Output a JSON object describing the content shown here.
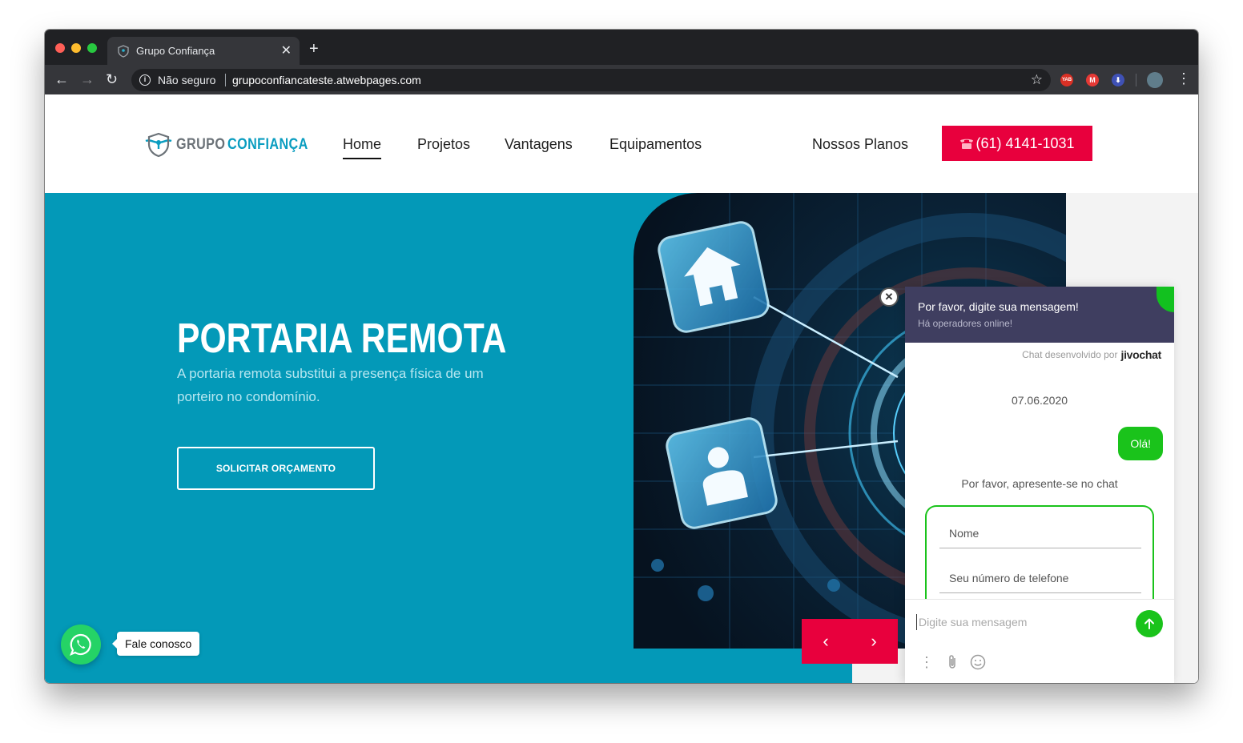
{
  "browser": {
    "tab_title": "Grupo Confiança",
    "security_label": "Não seguro",
    "url": "grupoconfiancateste.atwebpages.com",
    "extensions": [
      "YAB",
      "M",
      ""
    ]
  },
  "site": {
    "logo_part1": "GRUPO",
    "logo_part2": "CONFIANÇA",
    "menu": {
      "home": "Home",
      "projetos": "Projetos",
      "vantagens": "Vantagens",
      "equipamentos": "Equipamentos",
      "planos": "Nossos Planos"
    },
    "phone": "(61) 4141-1031",
    "colors": {
      "accent": "#e8003d",
      "hero": "#0399b8",
      "brand": "#0a9dc0"
    }
  },
  "hero": {
    "title": "PORTARIA REMOTA",
    "subtitle": "A portaria remota substitui a presença física de um porteiro no condomínio.",
    "cta": "SOLICITAR ORÇAMENTO"
  },
  "whatsapp": {
    "label": "Fale conosco"
  },
  "chat": {
    "title": "Por favor, digite sua mensagem!",
    "subtitle": "Há operadores online!",
    "powered_by": "Chat desenvolvido por",
    "brand": "jivochat",
    "date": "07.06.2020",
    "message_out": "Olá!",
    "intro_prompt": "Por favor, apresente-se no chat",
    "field_name": "Nome",
    "field_phone": "Seu número de telefone",
    "input_placeholder": "Digite sua mensagem",
    "colors": {
      "header": "#3f3e60",
      "green": "#1ac31b"
    }
  }
}
